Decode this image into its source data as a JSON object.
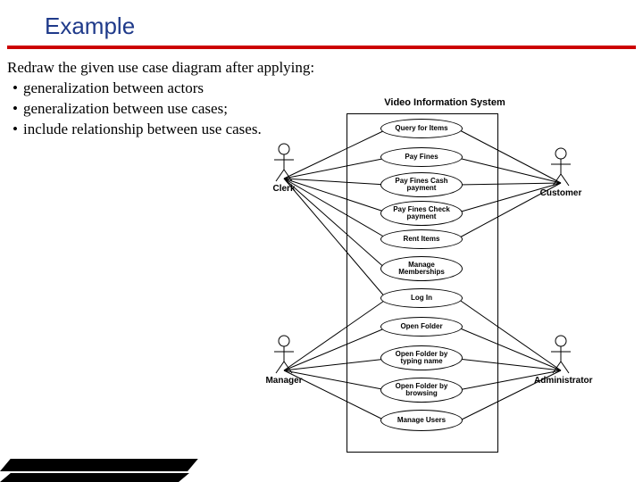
{
  "title": "Example",
  "instructions": {
    "lead": "Redraw the given use case diagram after applying:",
    "items": [
      "generalization between actors",
      "generalization between use cases;",
      "include relationship between use cases."
    ]
  },
  "diagram": {
    "system_name": "Video Information System",
    "actors": [
      {
        "name": "Clerk"
      },
      {
        "name": "Manager"
      },
      {
        "name": "Customer"
      },
      {
        "name": "Administrator"
      }
    ],
    "usecases": [
      {
        "id": "query",
        "label": "Query for Items"
      },
      {
        "id": "payfines",
        "label": "Pay Fines"
      },
      {
        "id": "paycash",
        "label": "Pay Fines\nCash payment"
      },
      {
        "id": "paycheck",
        "label": "Pay Fines\nCheck payment"
      },
      {
        "id": "rent",
        "label": "Rent Items"
      },
      {
        "id": "memberships",
        "label": "Manage\nMemberships"
      },
      {
        "id": "login",
        "label": "Log In"
      },
      {
        "id": "openfolder",
        "label": "Open Folder"
      },
      {
        "id": "opentype",
        "label": "Open Folder by\ntyping name"
      },
      {
        "id": "openbrowse",
        "label": "Open Folder by\nbrowsing"
      },
      {
        "id": "manageusers",
        "label": "Manage Users"
      }
    ],
    "associations": [
      [
        "Clerk",
        "query"
      ],
      [
        "Clerk",
        "payfines"
      ],
      [
        "Clerk",
        "paycash"
      ],
      [
        "Clerk",
        "paycheck"
      ],
      [
        "Clerk",
        "rent"
      ],
      [
        "Clerk",
        "memberships"
      ],
      [
        "Clerk",
        "login"
      ],
      [
        "Manager",
        "login"
      ],
      [
        "Manager",
        "openfolder"
      ],
      [
        "Manager",
        "opentype"
      ],
      [
        "Manager",
        "openbrowse"
      ],
      [
        "Manager",
        "manageusers"
      ],
      [
        "Customer",
        "query"
      ],
      [
        "Customer",
        "payfines"
      ],
      [
        "Customer",
        "paycash"
      ],
      [
        "Customer",
        "paycheck"
      ],
      [
        "Customer",
        "rent"
      ],
      [
        "Administrator",
        "login"
      ],
      [
        "Administrator",
        "openfolder"
      ],
      [
        "Administrator",
        "opentype"
      ],
      [
        "Administrator",
        "openbrowse"
      ],
      [
        "Administrator",
        "manageusers"
      ]
    ]
  }
}
